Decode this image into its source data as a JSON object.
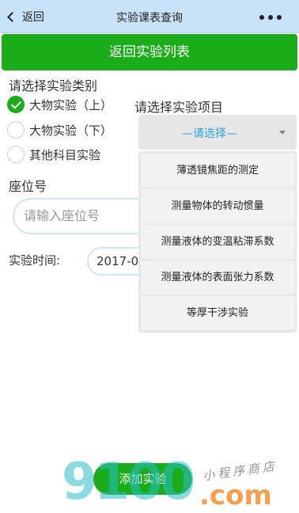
{
  "nav": {
    "back_label": "返回",
    "title": "实验课表查询"
  },
  "back_list_button": "返回实验列表",
  "category": {
    "label": "请选择实验类别",
    "options": [
      {
        "label": "大物实验（上）",
        "checked": true
      },
      {
        "label": "大物实验（下）",
        "checked": false
      },
      {
        "label": "其他科目实验",
        "checked": false
      }
    ]
  },
  "project": {
    "label": "请选择实验项目",
    "selected": "—请选择—",
    "options": [
      "薄透镜焦距的测定",
      "测量物体的转动惯量",
      "测量液体的变温粘滞系数",
      "测量液体的表面张力系数",
      "等厚干涉实验"
    ]
  },
  "seat": {
    "label": "座位号",
    "placeholder": "请输入座位号"
  },
  "time": {
    "label": "实验时间:",
    "value": "2017-0"
  },
  "add_button": "添加实验",
  "watermark": {
    "logo": "9100",
    "suffix": ".com",
    "tagline": "小程序商店"
  },
  "colors": {
    "nav_bg": "#c8e3f7",
    "accent_green": "#1aad19",
    "select_text": "#2aa4e3"
  }
}
